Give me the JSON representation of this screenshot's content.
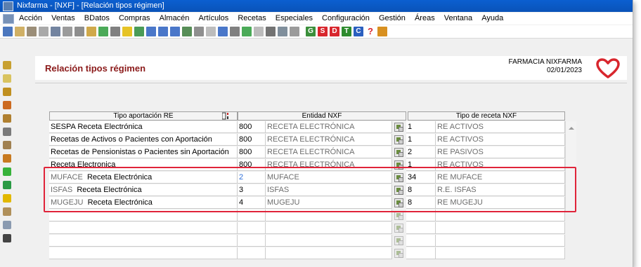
{
  "window": {
    "title": "Nixfarma - [NXF] - [Relación tipos régimen]"
  },
  "menu": {
    "items": [
      "Acción",
      "Ventas",
      "BDatos",
      "Compras",
      "Almacén",
      "Artículos",
      "Recetas",
      "Especiales",
      "Configuración",
      "Gestión",
      "Áreas",
      "Ventana",
      "Ayuda"
    ]
  },
  "toolbar": {
    "icons": [
      "exit-icon",
      "new-document-icon",
      "edit-icon",
      "settings-icon",
      "car-icon",
      "pencil-icon",
      "report-icon",
      "document-icon",
      "chart-icon",
      "copy-icon",
      "star-outline-icon",
      "star-icon",
      "forward-icon",
      "arrow-left-icon",
      "arrow-right-icon",
      "send-icon",
      "print-icon",
      "refresh-icon",
      "pin-icon",
      "brush-icon",
      "tools-icon",
      "home-icon",
      "stop-icon",
      "monitor-icon",
      "cart-icon"
    ],
    "letter_buttons": [
      "G",
      "S",
      "D",
      "T",
      "C"
    ],
    "letter_colors": [
      "#3b8f3b",
      "#d8262d",
      "#d8262d",
      "#2e8b2e",
      "#2a5fbf"
    ],
    "help_label": "?",
    "home_icon": "home-icon"
  },
  "sidebar": {
    "icons": [
      "printer-icon",
      "badge-icon",
      "user-icon",
      "cart-icon",
      "truck-icon",
      "pen-icon",
      "users-icon",
      "monitor-icon",
      "add-icon",
      "sync-icon",
      "warning-icon",
      "person-icon",
      "team-icon",
      "barcode-icon"
    ],
    "colors": [
      "#c8a030",
      "#d9c360",
      "#c09020",
      "#cc6a20",
      "#b08030",
      "#7a7a7a",
      "#a08050",
      "#c87a20",
      "#37b23a",
      "#2a9a44",
      "#e2b800",
      "#b0905a",
      "#8a9ab0",
      "#444444"
    ]
  },
  "header": {
    "title": "Relación tipos régimen",
    "pharmacy": "FARMACIA NIXFARMA",
    "date": "02/01/2023",
    "logo_color": "#d8262d"
  },
  "grid": {
    "columns": {
      "tipo_aportacion": "Tipo aportación RE",
      "entidad": "Entidad NXF",
      "tipo_receta": "Tipo de receta NXF"
    },
    "rows": [
      {
        "prefix": "",
        "name": "SESPA Receta Electrónica",
        "entidad_code": "800",
        "entidad_name": "RECETA ELECTRÓNICA",
        "receta_code": "1",
        "receta_name": "RE ACTIVOS"
      },
      {
        "prefix": "",
        "name": "Recetas de Activos o Pacientes con Aportación",
        "entidad_code": "800",
        "entidad_name": "RECETA ELECTRÓNICA",
        "receta_code": "1",
        "receta_name": "RE ACTIVOS"
      },
      {
        "prefix": "",
        "name": "Recetas de Pensionistas o Pacientes sin Aportación",
        "entidad_code": "800",
        "entidad_name": "RECETA ELECTRÓNICA",
        "receta_code": "2",
        "receta_name": "RE PASIVOS"
      },
      {
        "prefix": "",
        "name": "Receta Electronica",
        "entidad_code": "800",
        "entidad_name": "RECETA ELECTRÓNICA",
        "receta_code": "1",
        "receta_name": "RE ACTIVOS"
      },
      {
        "prefix": "MUFACE",
        "name": "Receta Electrónica",
        "entidad_code": "2",
        "entidad_name": "MUFACE",
        "receta_code": "34",
        "receta_name": "RE MUFACE"
      },
      {
        "prefix": "ISFAS",
        "name": "Receta Electrónica",
        "entidad_code": "3",
        "entidad_name": "ISFAS",
        "receta_code": "8",
        "receta_name": "R.E. ISFAS"
      },
      {
        "prefix": "MUGEJU",
        "name": "Receta Electrónica",
        "entidad_code": "4",
        "entidad_name": "MUGEJU",
        "receta_code": "8",
        "receta_name": "RE MUGEJU"
      }
    ]
  }
}
